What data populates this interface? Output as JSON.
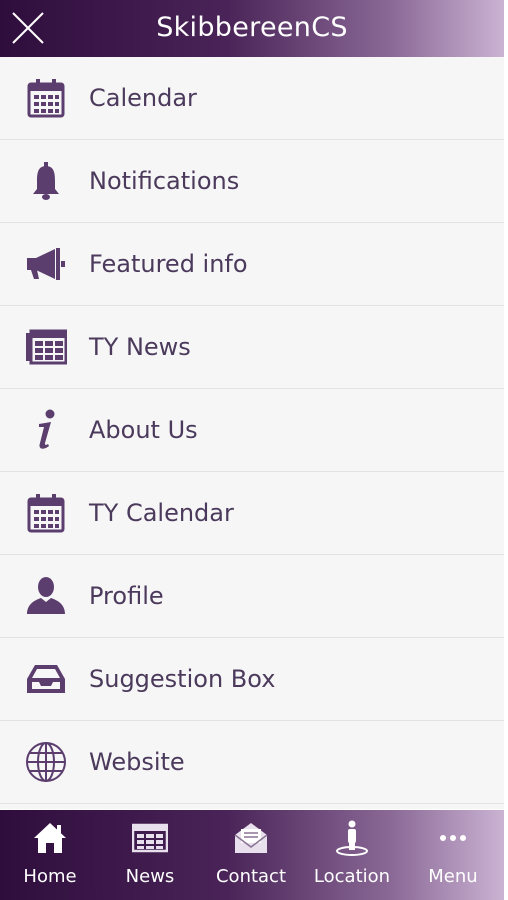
{
  "header": {
    "title": "SkibbereenCS"
  },
  "menu": {
    "items": [
      {
        "label": "Calendar",
        "icon": "calendar-icon"
      },
      {
        "label": "Notifications",
        "icon": "bell-icon"
      },
      {
        "label": "Featured info",
        "icon": "megaphone-icon"
      },
      {
        "label": "TY News",
        "icon": "newspaper-icon"
      },
      {
        "label": "About Us",
        "icon": "info-icon"
      },
      {
        "label": "TY Calendar",
        "icon": "calendar-icon"
      },
      {
        "label": "Profile",
        "icon": "user-icon"
      },
      {
        "label": "Suggestion Box",
        "icon": "inbox-tray-icon"
      },
      {
        "label": "Website",
        "icon": "globe-icon"
      }
    ]
  },
  "tabbar": {
    "items": [
      {
        "label": "Home",
        "icon": "home-icon"
      },
      {
        "label": "News",
        "icon": "newspaper-icon"
      },
      {
        "label": "Contact",
        "icon": "envelope-icon"
      },
      {
        "label": "Location",
        "icon": "location-person-icon"
      },
      {
        "label": "Menu",
        "icon": "more-dots-icon"
      }
    ]
  },
  "colors": {
    "header_gradient_start": "#2e0d3c",
    "header_gradient_end": "#cbb3d3",
    "icon_color": "#5b3d6e",
    "label_color": "#4b3a5c",
    "list_background": "#f6f6f6"
  }
}
